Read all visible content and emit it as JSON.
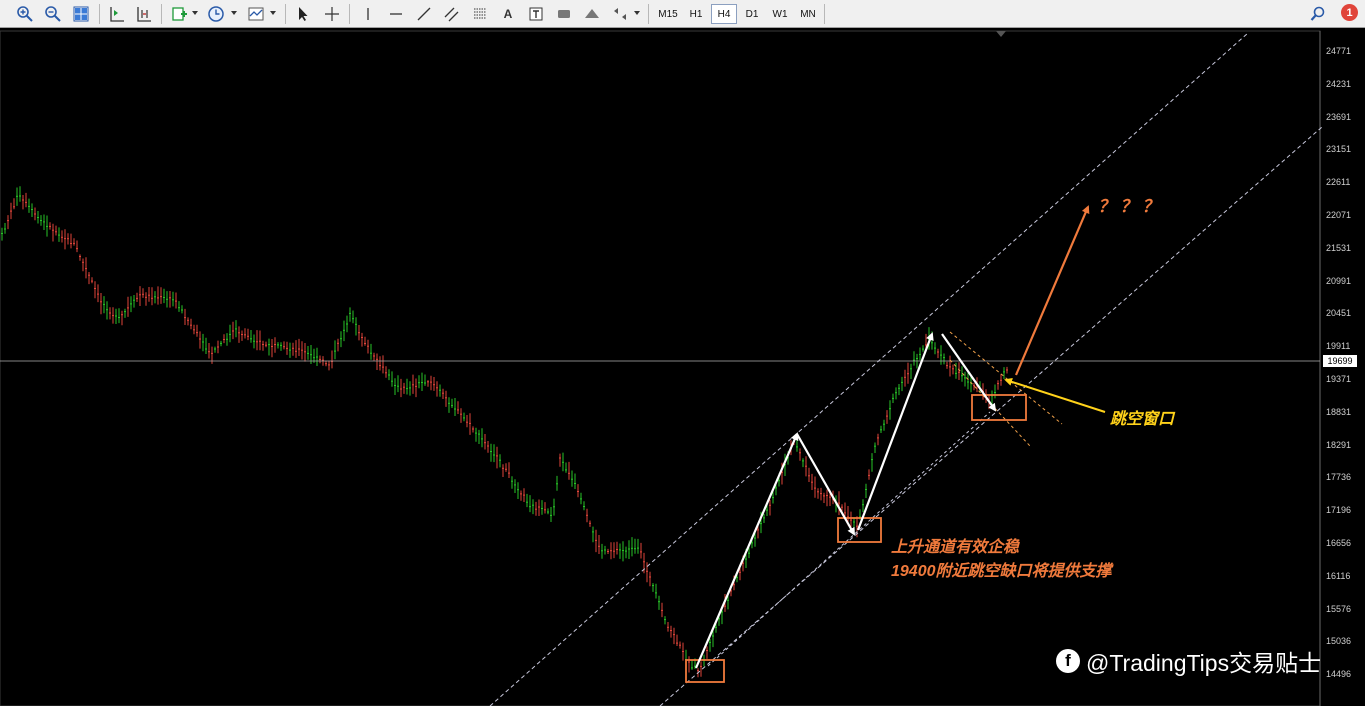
{
  "toolbar": {
    "timeframes": [
      {
        "label": "M15",
        "active": false
      },
      {
        "label": "H1",
        "active": false
      },
      {
        "label": "H4",
        "active": true
      },
      {
        "label": "D1",
        "active": false
      },
      {
        "label": "W1",
        "active": false
      },
      {
        "label": "MN",
        "active": false
      }
    ],
    "text_tool_label": "A",
    "notification_count": "1"
  },
  "price_axis": {
    "labels": [
      "24771",
      "24231",
      "23691",
      "23151",
      "22611",
      "22071",
      "21531",
      "20991",
      "20451",
      "19911",
      "19371",
      "18831",
      "18291",
      "17736",
      "17196",
      "16656",
      "16116",
      "15576",
      "15036",
      "14496"
    ],
    "current_price": "19699"
  },
  "annotations": {
    "question_marks": "？？？",
    "gap_label": "跳空窗口",
    "note_line1": "上升通道有效企稳",
    "note_line2": "19400附近跳空缺口将提供支撑"
  },
  "watermark": {
    "icon": "f",
    "text": "@TradingTips交易贴士"
  },
  "colors": {
    "bull_candle": "#27c427",
    "bear_candle": "#e0453a",
    "channel_line": "#c8c8dc",
    "annotation_orange": "#f07a3c",
    "annotation_yellow": "#ffd21a",
    "arrow_white": "#ffffff",
    "price_line": "#b0b0b0"
  }
}
